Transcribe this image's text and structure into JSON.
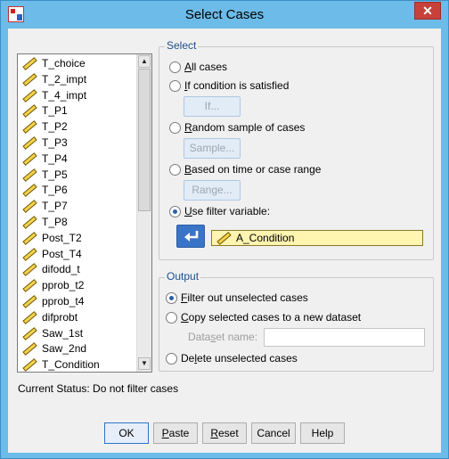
{
  "window": {
    "title": "Select Cases",
    "close_glyph": "✕",
    "icon": "spss-app-icon"
  },
  "variables": [
    "T_choice",
    "T_2_impt",
    "T_4_impt",
    "T_P1",
    "T_P2",
    "T_P3",
    "T_P4",
    "T_P5",
    "T_P6",
    "T_P7",
    "T_P8",
    "Post_T2",
    "Post_T4",
    "difodd_t",
    "pprob_t2",
    "pprob_t4",
    "difprobt",
    "Saw_1st",
    "Saw_2nd",
    "T_Condition"
  ],
  "variable_icon": "scale-ruler-icon",
  "select": {
    "legend": "Select",
    "options": [
      {
        "pre": "",
        "key": "A",
        "post": "ll cases",
        "checked": false
      },
      {
        "pre": "",
        "key": "I",
        "post": "f condition is satisfied",
        "checked": false
      },
      {
        "pre": "",
        "key": "R",
        "post": "andom sample of cases",
        "checked": false
      },
      {
        "pre": "",
        "key": "B",
        "post": "ased on time or case range",
        "checked": false
      },
      {
        "pre": "",
        "key": "U",
        "post": "se filter variable:",
        "checked": true
      }
    ],
    "if_button": "If...",
    "sample_button": "Sample...",
    "range_button": "Range...",
    "filter_variable": "A_Condition",
    "move_icon": "move-arrow-icon"
  },
  "output": {
    "legend": "Output",
    "options": [
      {
        "pre": "",
        "key": "F",
        "post": "ilter out unselected cases",
        "checked": true
      },
      {
        "pre": "",
        "key": "C",
        "post": "opy selected cases to a new dataset",
        "checked": false
      },
      {
        "pre": "De",
        "key": "l",
        "post": "ete unselected cases",
        "checked": false
      }
    ],
    "dataset_label_pre": "Data",
    "dataset_label_key": "s",
    "dataset_label_post": "et name:",
    "dataset_value": ""
  },
  "status": "Current Status: Do not filter cases",
  "buttons": {
    "ok": "OK",
    "paste_key": "P",
    "paste_rest": "aste",
    "reset_key": "R",
    "reset_rest": "eset",
    "cancel": "Cancel",
    "help": "Help"
  }
}
